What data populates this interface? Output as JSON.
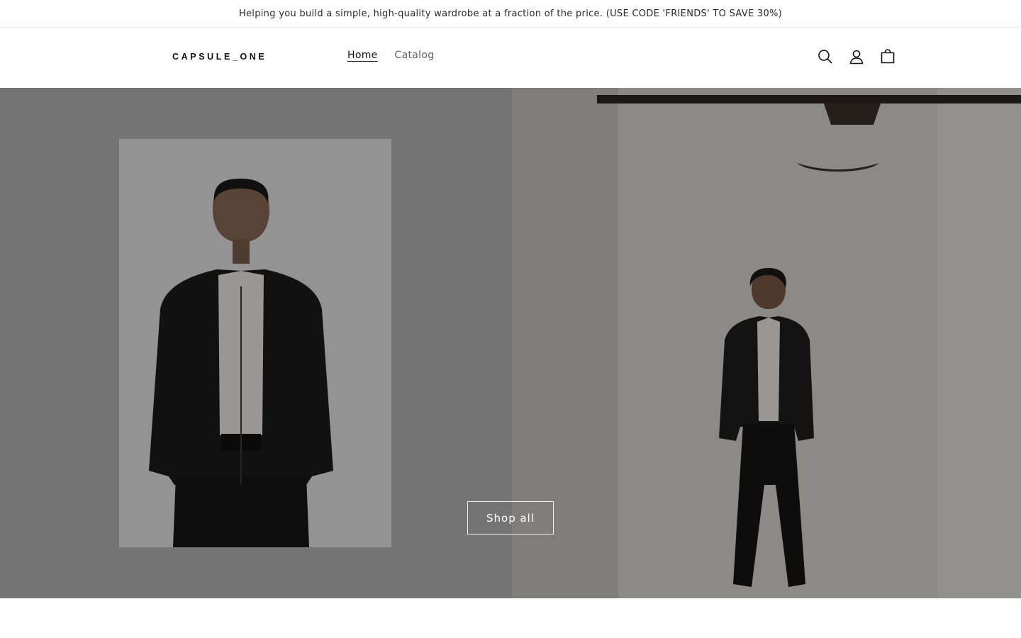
{
  "announcement": {
    "text": "Helping you build a simple, high-quality wardrobe at a fraction of the price. (USE CODE 'FRIENDS' TO SAVE 30%)"
  },
  "header": {
    "logo": "CAPSULE_ONE",
    "nav": [
      {
        "label": "Home",
        "active": true
      },
      {
        "label": "Catalog",
        "active": false
      }
    ],
    "icons": [
      "search-icon",
      "account-icon",
      "cart-icon"
    ]
  },
  "hero": {
    "button_label": "Shop all"
  },
  "colors": {
    "text": "#121212",
    "muted": "#5f5f5f",
    "overlay": "rgba(0,0,0,0.36)"
  }
}
